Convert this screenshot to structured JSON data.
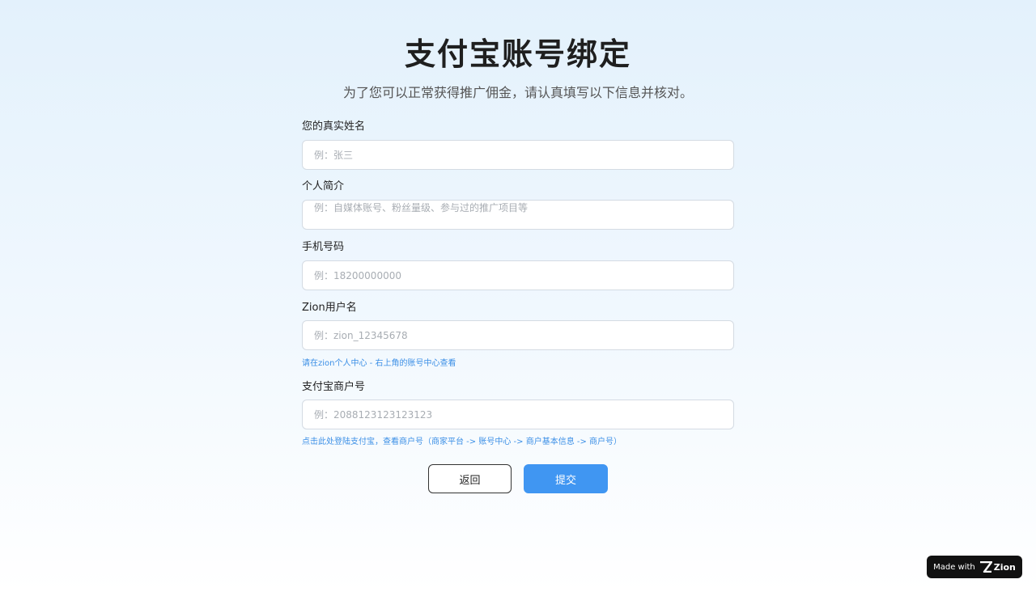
{
  "header": {
    "title": "支付宝账号绑定",
    "subtitle": "为了您可以正常获得推广佣金，请认真填写以下信息并核对。"
  },
  "form": {
    "name": {
      "label": "您的真实姓名",
      "placeholder": "例：张三",
      "value": ""
    },
    "bio": {
      "label": "个人简介",
      "placeholder": "例：自媒体账号、粉丝量级、参与过的推广项目等",
      "value": ""
    },
    "phone": {
      "label": "手机号码",
      "placeholder": "例：18200000000",
      "value": ""
    },
    "zion_username": {
      "label": "Zion用户名",
      "placeholder": "例：zion_12345678",
      "value": "",
      "hint": "请在zion个人中心 - 右上角的账号中心查看"
    },
    "alipay_merchant_id": {
      "label": "支付宝商户号",
      "placeholder": "例：2088123123123123",
      "value": "",
      "hint": "点击此处登陆支付宝，查看商户号（商家平台 -> 账号中心 -> 商户基本信息 -> 商户号）"
    }
  },
  "actions": {
    "back_label": "返回",
    "submit_label": "提交"
  },
  "badge": {
    "made_with": "Made with",
    "brand": "Zion",
    "icon": "zion-logo-icon"
  },
  "colors": {
    "primary": "#4096f2",
    "hint": "#3b8fe6",
    "badge_bg": "#111111"
  }
}
